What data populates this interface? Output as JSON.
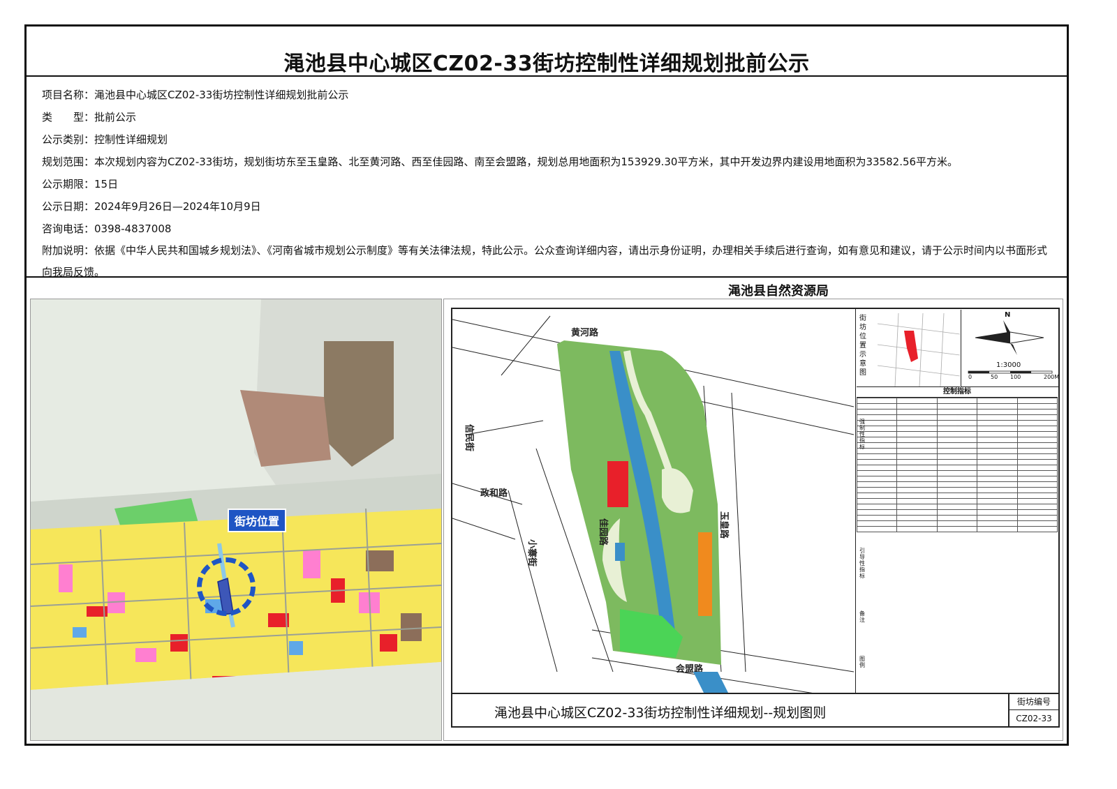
{
  "title": "渑池县中心城区CZ02-33街坊控制性详细规划批前公示",
  "info": {
    "project_label": "项目名称：",
    "project_value": "渑池县中心城区CZ02-33街坊控制性详细规划批前公示",
    "type_label": "类　　型：",
    "type_value": "批前公示",
    "category_label": "公示类别：",
    "category_value": "控制性详细规划",
    "scope_label": "规划范围：",
    "scope_value": "本次规划内容为CZ02-33街坊，规划街坊东至玉皇路、北至黄河路、西至佳园路、南至会盟路，规划总用地面积为153929.30平方米，其中开发边界内建设用地面积为33582.56平方米。",
    "period_label": "公示期限：",
    "period_value": "15日",
    "date_label": "公示日期：",
    "date_value": "2024年9月26日—2024年10月9日",
    "phone_label": "咨询电话：",
    "phone_value": "0398-4837008",
    "note_label": "附加说明：",
    "note_value": "依据《中华人民共和国城乡规划法》、《河南省城市规划公示制度》等有关法律法规，特此公示。公众查询详细内容，请出示身份证明，办理相关手续后进行查询，如有意见和建议，请于公示时间内以书面形式向我局反馈。"
  },
  "issuer": "渑池县自然资源局",
  "left_map": {
    "callout": "街坊位置"
  },
  "plan_map": {
    "roads": {
      "huanghe": "黄河路",
      "xinmin": "信民街",
      "zhenghe": "政和路",
      "jiayuan": "佳园路",
      "xiaozhai": "小寨街",
      "yuhuang": "玉皇路",
      "huimeng": "会盟路"
    },
    "side": {
      "location_label": "街坊位置示意图",
      "north": "N",
      "scale": "1:3000",
      "ticks": [
        "0",
        "50",
        "100",
        "200M"
      ],
      "control_header": "控制指标",
      "group_a": "强制性指标",
      "group_b": "引导性指标",
      "group_c": "备注",
      "group_d": "图例"
    },
    "footer_title": "渑池县中心城区CZ02-33街坊控制性详细规划--规划图则",
    "code_label": "街坊编号",
    "code_value": "CZ02-33"
  },
  "colors": {
    "park": "#7dba5f",
    "water": "#3a8fc8",
    "commercial": "#e8202a",
    "public": "#f08a1e",
    "residential": "#f7e94a",
    "callout": "#1f55c4"
  }
}
